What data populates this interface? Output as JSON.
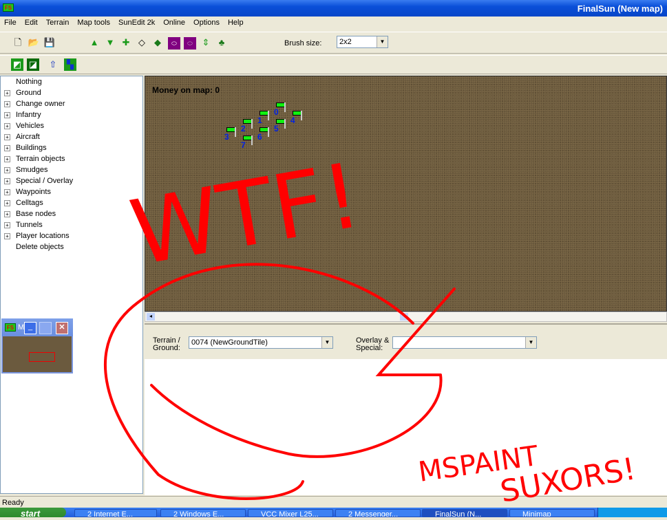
{
  "window": {
    "title": "FinalSun (New map)",
    "app_icon": "FS"
  },
  "menu": [
    "File",
    "Edit",
    "Terrain",
    "Map tools",
    "SunEdit 2k",
    "Online",
    "Options",
    "Help"
  ],
  "toolbar": {
    "brush_label": "Brush size:",
    "brush_value": "2x2",
    "icons": [
      "new-file-icon",
      "open-folder-icon",
      "save-icon",
      "raise-ground-icon",
      "lower-ground-icon",
      "flatten-icon",
      "hide-tile-icon",
      "show-tile-icon",
      "hide-object-icon",
      "show-object-icon",
      "raise-tile-icon",
      "lower-tile-icon"
    ],
    "row2_icons": [
      "cliff-front-icon",
      "cliff-back-icon",
      "shore-icon",
      "water-icon"
    ]
  },
  "tree": [
    {
      "label": "Nothing",
      "expand": false
    },
    {
      "label": "Ground",
      "expand": true
    },
    {
      "label": "Change owner",
      "expand": true
    },
    {
      "label": "Infantry",
      "expand": true
    },
    {
      "label": "Vehicles",
      "expand": true
    },
    {
      "label": "Aircraft",
      "expand": true
    },
    {
      "label": "Buildings",
      "expand": true
    },
    {
      "label": "Terrain objects",
      "expand": true
    },
    {
      "label": "Smudges",
      "expand": true
    },
    {
      "label": "Special / Overlay",
      "expand": true
    },
    {
      "label": "Waypoints",
      "expand": true
    },
    {
      "label": "Celltags",
      "expand": true
    },
    {
      "label": "Base nodes",
      "expand": true
    },
    {
      "label": "Tunnels",
      "expand": true
    },
    {
      "label": "Player locations",
      "expand": true
    },
    {
      "label": "Delete objects",
      "expand": false
    }
  ],
  "map": {
    "money_label": "Money on map: 0",
    "waypoints": [
      "0",
      "1",
      "2",
      "3",
      "4",
      "5",
      "6",
      "7"
    ],
    "ground_color": "#6b5a3e"
  },
  "lower": {
    "terrain_label_1": "Terrain /",
    "terrain_label_2": "Ground:",
    "terrain_value": "0074 (NewGroundTile)",
    "overlay_label_1": "Overlay &",
    "overlay_label_2": "Special:",
    "overlay_value": ""
  },
  "status": "Ready",
  "taskbar": {
    "start": "start",
    "tasks": [
      "2 Internet E...",
      "2 Windows E...",
      "VCC Mixer L25...",
      "2 Messenger...",
      "FinalSun (N...",
      "Minimap"
    ]
  },
  "minimap": {
    "title": "M"
  },
  "annotation": {
    "text1": "WTF!",
    "text2": "MSPAINT",
    "text3": "SUXORS!",
    "color": "#ff0000"
  }
}
